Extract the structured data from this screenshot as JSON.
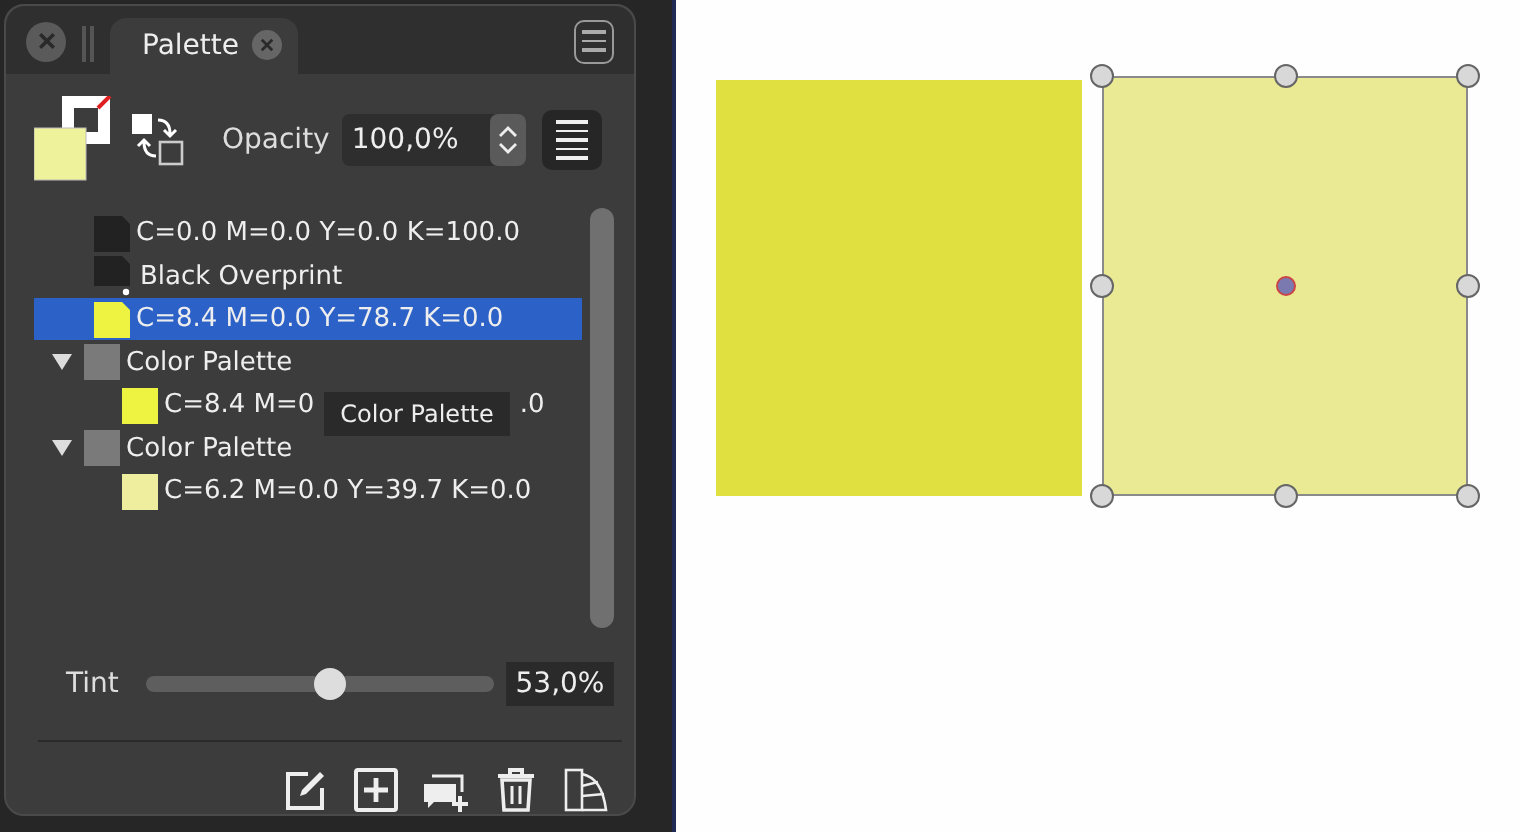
{
  "panel": {
    "tabs": [
      {
        "label": "Palette",
        "selected": true
      }
    ],
    "opacity": {
      "label": "Opacity",
      "value": "100,0%"
    },
    "swatches": [
      {
        "kind": "global",
        "label": "C=0.0 M=0.0 Y=0.0 K=100.0",
        "color": "#222222",
        "selected": false
      },
      {
        "kind": "overprint",
        "label": "Black Overprint",
        "color": "#222222",
        "selected": false
      },
      {
        "kind": "global",
        "label": "C=8.4 M=0.0 Y=78.7 K=0.0",
        "color": "#eef240",
        "selected": true
      },
      {
        "kind": "group",
        "label": "Color Palette",
        "color": "#7a7a7a",
        "expanded": true,
        "selected": false,
        "children": [
          {
            "kind": "plain",
            "label": "C=8.4 M=0",
            "label_end": ".0",
            "color": "#eef240",
            "selected": false,
            "tooltip": "Color Palette"
          }
        ]
      },
      {
        "kind": "group",
        "label": "Color Palette",
        "color": "#7a7a7a",
        "expanded": true,
        "selected": false,
        "children": [
          {
            "kind": "plain",
            "label": "C=6.2 M=0.0 Y=39.7 K=0.0",
            "color": "#eeee9e",
            "selected": false
          }
        ]
      }
    ],
    "tint": {
      "label": "Tint",
      "level": 0.53,
      "value": "53,0%"
    }
  },
  "canvas": {
    "shapes": [
      {
        "color": "#e0e040",
        "selected": false
      },
      {
        "color": "#eaea94",
        "selected": true
      }
    ]
  }
}
